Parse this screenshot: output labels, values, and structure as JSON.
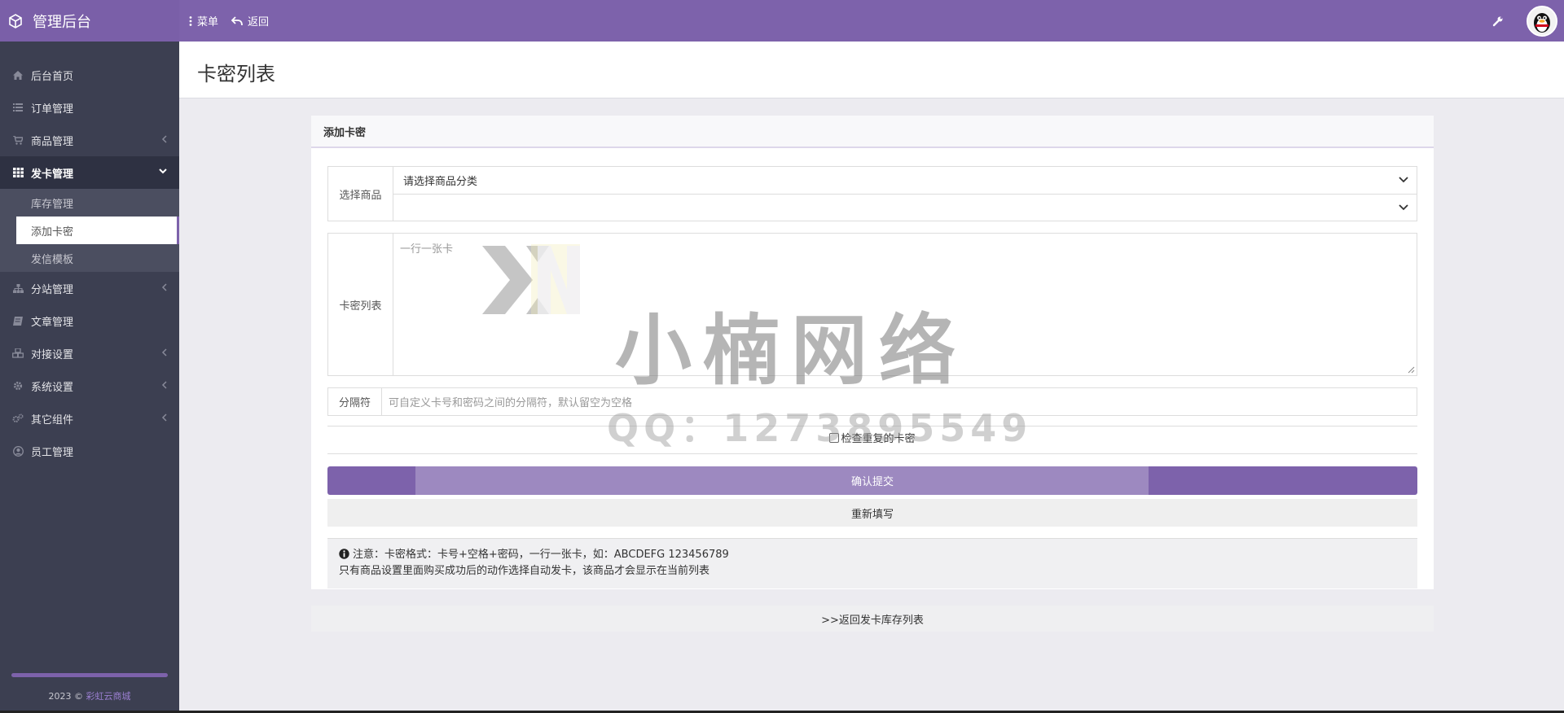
{
  "topbar": {
    "brand": "管理后台",
    "nav": [
      {
        "label": "菜单",
        "icon": "vertical-dots-icon"
      },
      {
        "label": "返回",
        "icon": "undo-icon"
      }
    ]
  },
  "sidebar": {
    "items": [
      {
        "label": "后台首页",
        "icon": "home-icon",
        "has_arrow": false
      },
      {
        "label": "订单管理",
        "icon": "list-icon",
        "has_arrow": false
      },
      {
        "label": "商品管理",
        "icon": "cart-icon",
        "has_arrow": true
      },
      {
        "label": "发卡管理",
        "icon": "grid-icon",
        "has_arrow": true,
        "active": true
      },
      {
        "label": "分站管理",
        "icon": "sitemap-icon",
        "has_arrow": true
      },
      {
        "label": "文章管理",
        "icon": "book-icon",
        "has_arrow": false
      },
      {
        "label": "对接设置",
        "icon": "cubes-icon",
        "has_arrow": true
      },
      {
        "label": "系统设置",
        "icon": "gear-icon",
        "has_arrow": true
      },
      {
        "label": "其它组件",
        "icon": "gears-icon",
        "has_arrow": true
      },
      {
        "label": "员工管理",
        "icon": "user-circle-icon",
        "has_arrow": false
      }
    ],
    "submenu": [
      {
        "label": "库存管理"
      },
      {
        "label": "添加卡密",
        "active": true
      },
      {
        "label": "发信模板"
      }
    ],
    "footer": {
      "year": "2023 ©",
      "link": "彩虹云商城"
    }
  },
  "page": {
    "title": "卡密列表"
  },
  "panel": {
    "heading": "添加卡密",
    "select_label": "选择商品",
    "select_category": "请选择商品分类",
    "select_product": "",
    "cards_label": "卡密列表",
    "cards_placeholder": "一行一张卡",
    "separator_label": "分隔符",
    "separator_placeholder": "可自定义卡号和密码之间的分隔符，默认留空为空格",
    "check_duplicate_label": "检查重复的卡密",
    "submit_label": "确认提交",
    "reset_label": "重新填写",
    "note_line1": "注意：卡密格式：卡号+空格+密码，一行一张卡，如：ABCDEFG 123456789",
    "note_line2": "只有商品设置里面购买成功后的动作选择自动发卡，该商品才会显示在当前列表"
  },
  "back_link": ">>返回发卡库存列表",
  "watermark": {
    "text": "小楠网络",
    "qq": "QQ：1273895549"
  },
  "colors": {
    "accent": "#7d62ab",
    "sidebar": "#3c3f51",
    "background": "#ecebf0"
  }
}
